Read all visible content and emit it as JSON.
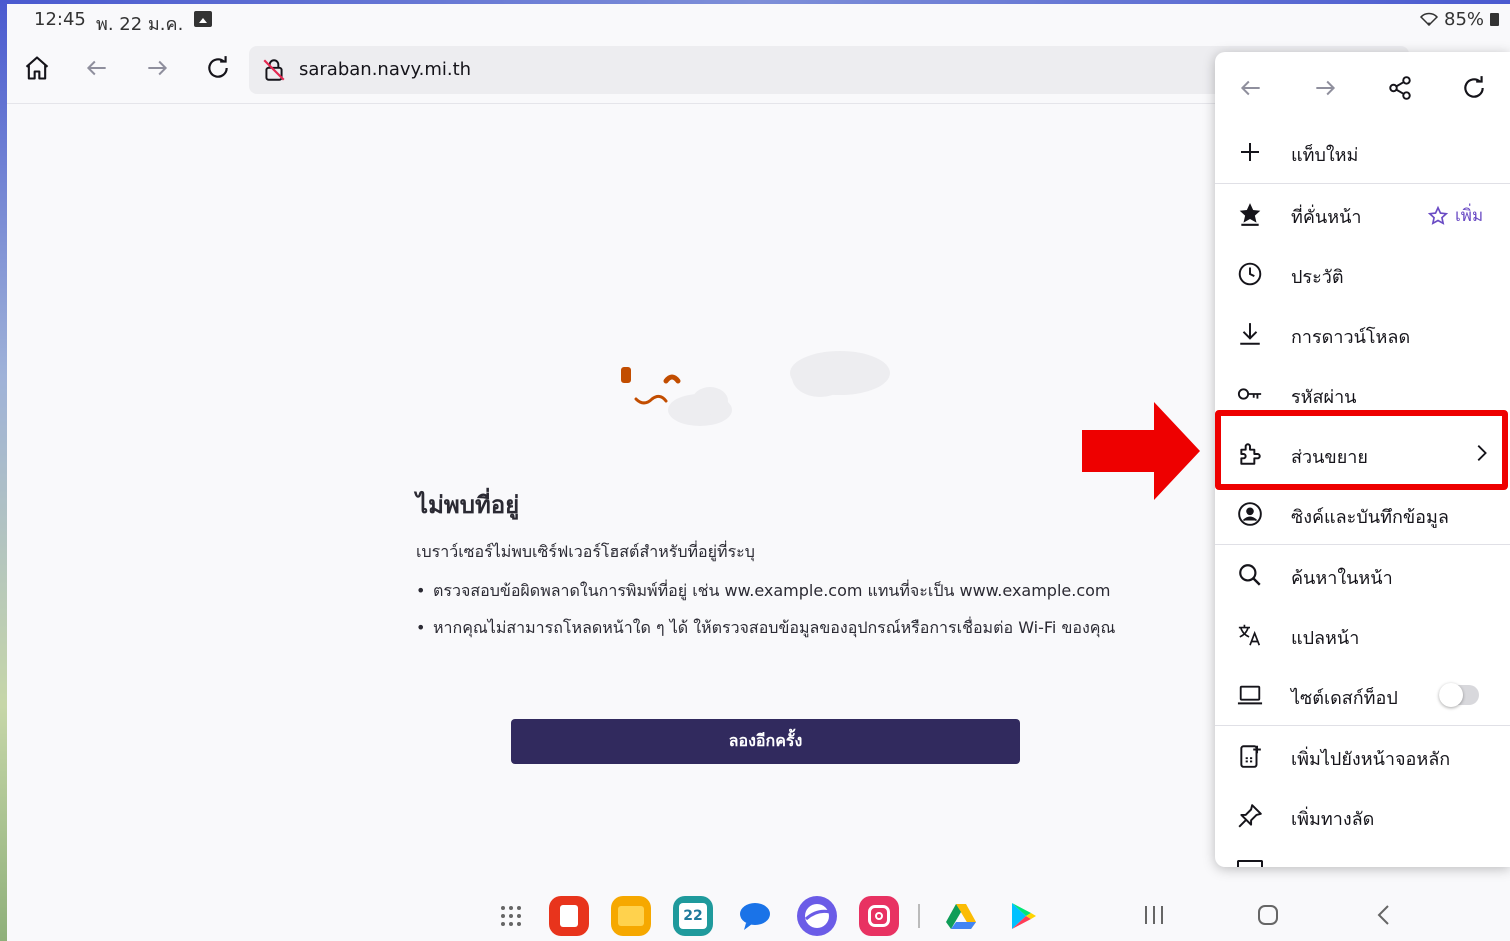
{
  "status_bar": {
    "time": "12:45",
    "date": "พ. 22 ม.ค.",
    "battery": "85%"
  },
  "toolbar": {
    "url": "saraban.navy.mi.th"
  },
  "error_page": {
    "title": "ไม่พบที่อยู่",
    "description": "เบราว์เซอร์ไม่พบเซิร์ฟเวอร์โฮสต์สำหรับที่อยู่ที่ระบุ",
    "bullets": [
      "ตรวจสอบข้อผิดพลาดในการพิมพ์ที่อยู่ เช่น ww.example.com แทนที่จะเป็น www.example.com",
      "หากคุณไม่สามารถโหลดหน้าใด ๆ ได้ ให้ตรวจสอบข้อมูลของอุปกรณ์หรือการเชื่อมต่อ Wi-Fi ของคุณ"
    ],
    "retry_label": "ลองอีกครั้ง"
  },
  "menu": {
    "items": [
      {
        "label": "แท็บใหม่",
        "icon": "plus-icon"
      },
      {
        "label": "ที่คั่นหน้า",
        "icon": "star-icon",
        "action_label": "เพิ่ม"
      },
      {
        "label": "ประวัติ",
        "icon": "clock-icon"
      },
      {
        "label": "การดาวน์โหลด",
        "icon": "download-icon"
      },
      {
        "label": "รหัสผ่าน",
        "icon": "key-icon"
      },
      {
        "label": "ส่วนขยาย",
        "icon": "puzzle-icon"
      },
      {
        "label": "ซิงค์และบันทึกข้อมูล",
        "icon": "account-icon"
      },
      {
        "label": "ค้นหาในหน้า",
        "icon": "search-icon"
      },
      {
        "label": "แปลหน้า",
        "icon": "translate-icon"
      },
      {
        "label": "ไซต์เดสก์ท็อป",
        "icon": "laptop-icon",
        "toggle": false
      },
      {
        "label": "เพิ่มไปยังหน้าจอหลัก",
        "icon": "add-home-icon"
      },
      {
        "label": "เพิ่มทางลัด",
        "icon": "pin-icon"
      }
    ]
  },
  "colors": {
    "accent": "#312a5e",
    "link_purple": "#6a4bc4",
    "highlight_red": "#ee0000",
    "background": "#f9f9fb"
  },
  "taskbar": {
    "calendar_day": "22"
  }
}
